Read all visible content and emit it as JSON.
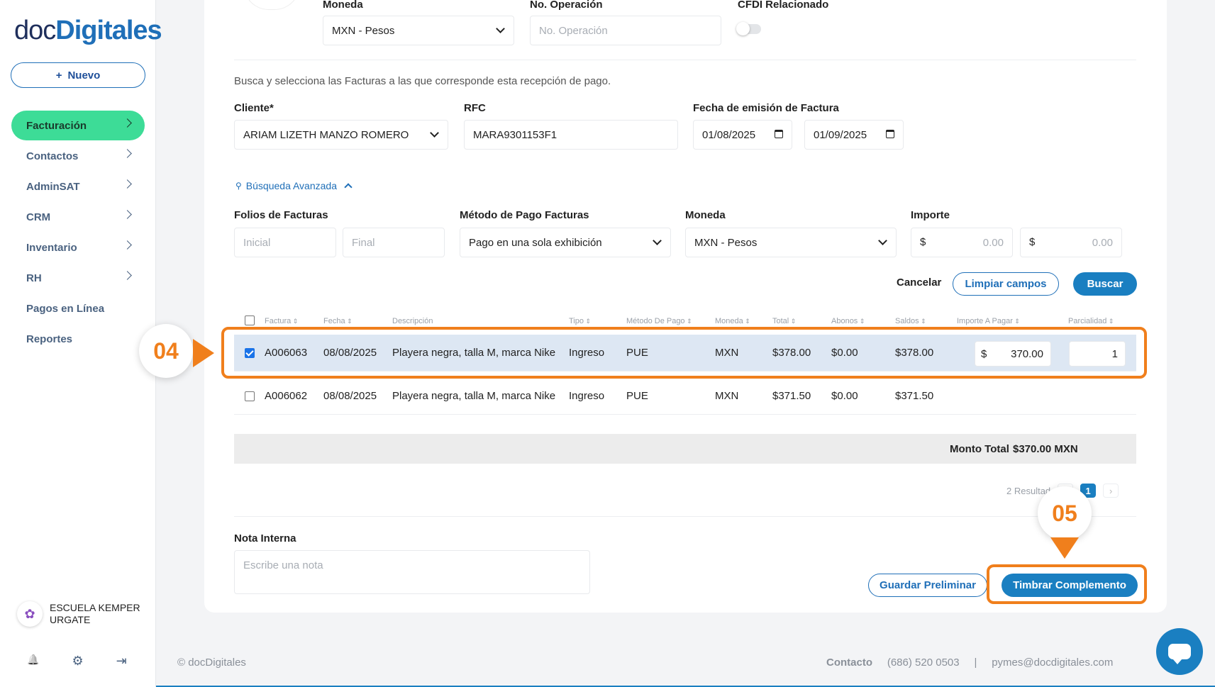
{
  "sidebar": {
    "logo_a": "doc",
    "logo_b": "Digitales",
    "new_icon": "+",
    "new_label": "Nuevo",
    "items": [
      {
        "label": "Facturación"
      },
      {
        "label": "Contactos"
      },
      {
        "label": "AdminSAT"
      },
      {
        "label": "CRM"
      },
      {
        "label": "Inventario"
      },
      {
        "label": "RH"
      },
      {
        "label": "Pagos en Línea"
      },
      {
        "label": "Reportes"
      }
    ],
    "org_line1": "ESCUELA KEMPER",
    "org_line2": "URGATE",
    "icons": {
      "bell": "🔔",
      "gear": "⚙",
      "logout": "⇥"
    }
  },
  "payment": {
    "moneda_label": "Moneda",
    "moneda_value": "MXN - Pesos",
    "operacion_label": "No. Operación",
    "operacion_placeholder": "No. Operación",
    "cfdi_label": "CFDI Relacionado"
  },
  "search": {
    "hint": "Busca y selecciona las Facturas a las que corresponde esta recepción de pago.",
    "cliente_label": "Cliente*",
    "cliente_value": "ARIAM LIZETH MANZO ROMERO",
    "rfc_label": "RFC",
    "rfc_value": "MARA9301153F1",
    "fecha_label": "Fecha de emisión de Factura",
    "fecha_from": "01/08/2025",
    "fecha_to": "01/09/2025",
    "advanced_label": "Búsqueda Avanzada",
    "folios_label": "Folios de Facturas",
    "folio_inicial": "Inicial",
    "folio_final": "Final",
    "metodo_label": "Método de Pago Facturas",
    "metodo_value": "Pago en una sola exhibición",
    "moneda_label": "Moneda",
    "moneda_value": "MXN - Pesos",
    "importe_label": "Importe",
    "currency": "$",
    "importe_min": "0.00",
    "importe_max": "0.00",
    "cancel": "Cancelar",
    "clear": "Limpiar campos",
    "search": "Buscar"
  },
  "table": {
    "headers": [
      "Factura",
      "Fecha",
      "Descripción",
      "Tipo",
      "Método De Pago",
      "Moneda",
      "Total",
      "Abonos",
      "Saldos",
      "Importe A Pagar",
      "Parcialidad"
    ],
    "rows": [
      {
        "factura": "A006063",
        "fecha": "08/08/2025",
        "descripcion": "Playera negra, talla M, marca Nike",
        "tipo": "Ingreso",
        "metodo": "PUE",
        "moneda": "MXN",
        "total": "$378.00",
        "abonos": "$0.00",
        "saldos": "$378.00",
        "importe_cur": "$",
        "importe": "370.00",
        "parcialidad": "1",
        "checked": true
      },
      {
        "factura": "A006062",
        "fecha": "08/08/2025",
        "descripcion": "Playera negra, talla M, marca Nike",
        "tipo": "Ingreso",
        "metodo": "PUE",
        "moneda": "MXN",
        "total": "$371.50",
        "abonos": "$0.00",
        "saldos": "$371.50",
        "checked": false
      }
    ],
    "total_label": "Monto Total",
    "total_value": "$370.00 MXN",
    "results": "2 Resultad",
    "page": "1",
    "prev": "‹",
    "next": "›"
  },
  "notes": {
    "label": "Nota Interna",
    "placeholder": "Escribe una nota"
  },
  "actions": {
    "preliminar": "Guardar Preliminar",
    "timbrar": "Timbrar Complemento"
  },
  "annotations": {
    "step1": "04",
    "step2": "05",
    "color": "#f07f1c"
  },
  "footer": {
    "copyright": "© docDigitales",
    "contact_label": "Contacto",
    "phone": "(686) 520 0503",
    "separator": "|",
    "email": "pymes@docdigitales.com"
  }
}
